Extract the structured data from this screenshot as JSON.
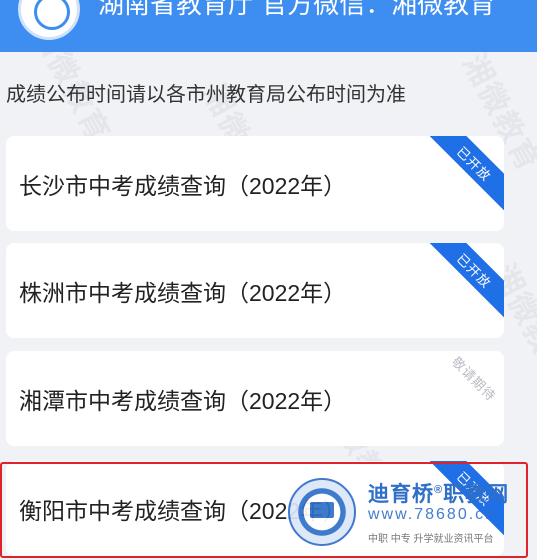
{
  "header": {
    "title": "湖南省教育厅 官方微信：湘微教育"
  },
  "notice": "成绩公布时间请以各市州教育局公布时间为准",
  "watermark_text": "湘微教育",
  "cards": [
    {
      "label": "长沙市中考成绩查询（2022年）",
      "status": "已开放"
    },
    {
      "label": "株洲市中考成绩查询（2022年）",
      "status": "已开放"
    },
    {
      "label": "湘潭市中考成绩查询（2022年）",
      "status": "敬请期待"
    },
    {
      "label": "衡阳市中考成绩查询（2022年）",
      "status": "已开放"
    }
  ],
  "brand": {
    "name": "迪育桥",
    "name_suffix": "职教网",
    "registered": "®",
    "url": "www.78680.cn",
    "tagline": "中职 中专 升学就业资讯平台"
  },
  "colors": {
    "header": "#3d8ef0",
    "ribbon_open": "#1f6fe6",
    "highlight": "#e0222a"
  }
}
